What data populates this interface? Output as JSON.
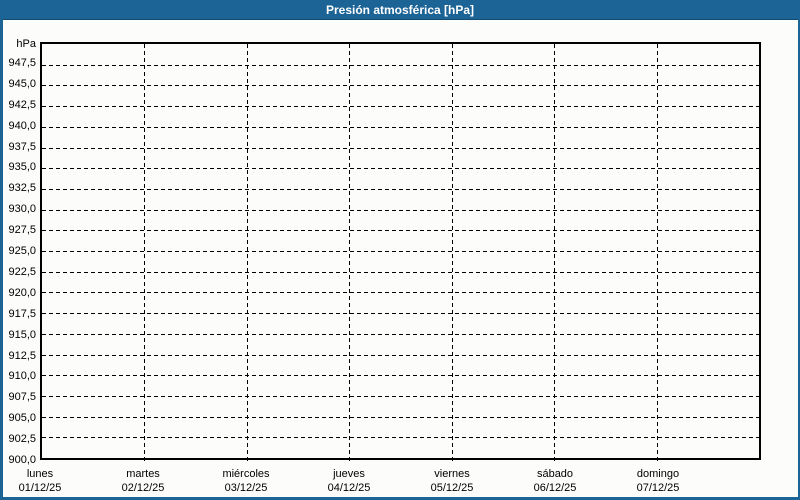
{
  "window": {
    "title": "Presión atmosférica [hPa]"
  },
  "colors": {
    "title_bar": "#1c6396",
    "title_text": "#ffffff",
    "frame_border": "#1c6396",
    "grid": "#000000",
    "axis": "#000000",
    "background": "#fcfdfa"
  },
  "chart_data": {
    "type": "line",
    "title": "Presión atmosférica [hPa]",
    "grid": "dashed",
    "legend": "none",
    "y_axis": {
      "unit": "hPa",
      "min": 900,
      "max": 950,
      "tick_step": 2.5,
      "tick_labels": [
        "900,0",
        "902,5",
        "905,0",
        "907,5",
        "910,0",
        "912,5",
        "915,0",
        "917,5",
        "920,0",
        "922,5",
        "925,0",
        "927,5",
        "930,0",
        "932,5",
        "935,0",
        "937,5",
        "940,0",
        "942,5",
        "945,0",
        "947,5"
      ]
    },
    "x_axis": {
      "days": [
        {
          "name": "lunes",
          "date": "01/12/25"
        },
        {
          "name": "martes",
          "date": "02/12/25"
        },
        {
          "name": "miércoles",
          "date": "03/12/25"
        },
        {
          "name": "jueves",
          "date": "04/12/25"
        },
        {
          "name": "viernes",
          "date": "05/12/25"
        },
        {
          "name": "sábado",
          "date": "06/12/25"
        },
        {
          "name": "domingo",
          "date": "07/12/25"
        }
      ]
    },
    "series": []
  }
}
